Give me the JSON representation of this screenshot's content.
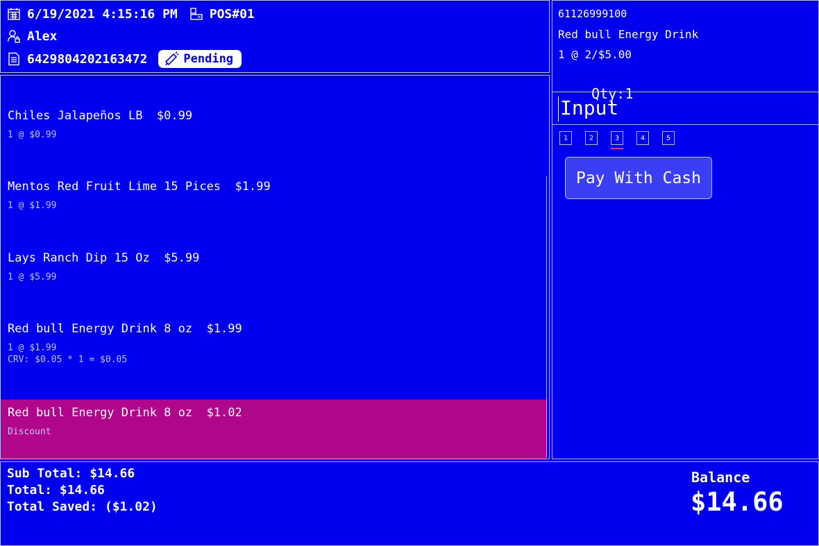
{
  "header": {
    "datetime": "6/19/2021 4:15:16 PM",
    "pos": "POS#01",
    "user": "Alex",
    "order_id": "6429804202163472",
    "status": "Pending",
    "icons": [
      "calendar-icon",
      "register-icon",
      "user-lock-icon",
      "receipt-icon",
      "megaphone-icon"
    ]
  },
  "cart": {
    "items": [
      {
        "name": "Chiles Jalapeños LB  $0.99",
        "detail": "1 @ $0.99"
      },
      {
        "name": "Mentos Red Fruit Lime 15 Pices  $1.99",
        "detail": "1 @ $1.99"
      },
      {
        "name": "Lays Ranch Dip 15 Oz  $5.99",
        "detail": "1 @ $5.99"
      },
      {
        "name": "Red bull Energy Drink 8 oz  $1.99",
        "detail": "1 @ $1.99",
        "crv": "CRV: $0.05 * 1 = $0.05"
      },
      {
        "name": "Red bull Energy Drink 8 oz  $1.02",
        "detail": "Discount",
        "selected": true
      }
    ]
  },
  "detail": {
    "barcode": "61126999100",
    "name": "Red bull Energy Drink",
    "price": "1 @ 2/$5.00",
    "qty_label": "Qty:",
    "qty_value": "1",
    "input_placeholder": "Input",
    "pages": [
      "1",
      "2",
      "3",
      "4",
      "5"
    ],
    "active_page": "3",
    "pay_button": "Pay With Cash"
  },
  "footer": {
    "sub_total": "Sub Total: $14.66",
    "total": "Total: $14.66",
    "total_saved": "Total Saved: ($1.02)",
    "balance_label": "Balance",
    "balance_value": "$14.66"
  },
  "colors": {
    "background": "#0000ee",
    "selected_row": "#b0068b",
    "pay_button": "#3a3ff3",
    "active_page_underline": "#ff2a6d"
  }
}
